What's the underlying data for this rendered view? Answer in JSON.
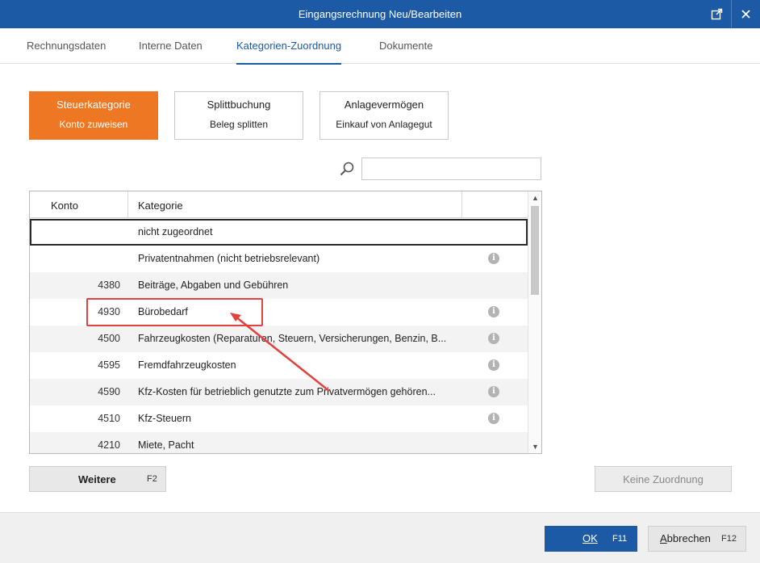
{
  "window": {
    "title": "Eingangsrechnung Neu/Bearbeiten",
    "popout_icon": "external-link-icon",
    "close_icon": "close-icon"
  },
  "tabs": [
    {
      "label": "Rechnungsdaten",
      "active": false
    },
    {
      "label": "Interne Daten",
      "active": false
    },
    {
      "label": "Kategorien-Zuordnung",
      "active": true
    },
    {
      "label": "Dokumente",
      "active": false
    }
  ],
  "category_buttons": [
    {
      "title": "Steuerkategorie",
      "subtitle": "Konto zuweisen",
      "active": true
    },
    {
      "title": "Splittbuchung",
      "subtitle": "Beleg splitten",
      "active": false
    },
    {
      "title": "Anlagevermögen",
      "subtitle": "Einkauf von Anlagegut",
      "active": false
    }
  ],
  "search": {
    "value": "",
    "placeholder": ""
  },
  "grid": {
    "columns": {
      "konto": "Konto",
      "kategorie": "Kategorie"
    },
    "rows": [
      {
        "konto": "",
        "kategorie": "nicht zugeordnet",
        "info": false,
        "selected": true
      },
      {
        "konto": "",
        "kategorie": "Privatentnahmen  (nicht betriebsrelevant)",
        "info": true
      },
      {
        "konto": "4380",
        "kategorie": "Beiträge, Abgaben und Gebühren",
        "info": false
      },
      {
        "konto": "4930",
        "kategorie": "Bürobedarf",
        "info": true
      },
      {
        "konto": "4500",
        "kategorie": "Fahrzeugkosten (Reparaturen, Steuern, Versicherungen, Benzin, B...",
        "info": true
      },
      {
        "konto": "4595",
        "kategorie": "Fremdfahrzeugkosten",
        "info": true
      },
      {
        "konto": "4590",
        "kategorie": "Kfz-Kosten für betrieblich genutzte zum Privatvermögen gehören...",
        "info": true
      },
      {
        "konto": "4510",
        "kategorie": "Kfz-Steuern",
        "info": true
      },
      {
        "konto": "4210",
        "kategorie": "Miete, Pacht",
        "info": false
      }
    ]
  },
  "buttons": {
    "weitere": {
      "label": "Weitere",
      "key": "F2"
    },
    "keine_zuordnung": {
      "label": "Keine Zuordnung"
    },
    "ok": {
      "label": "OK",
      "key": "F11"
    },
    "abbrechen": {
      "label_u": "A",
      "label_rest": "bbrechen",
      "key": "F12"
    }
  },
  "colors": {
    "titlebar": "#1c5aa6",
    "accent_orange": "#ee7723",
    "annotation_red": "#e3413f"
  }
}
